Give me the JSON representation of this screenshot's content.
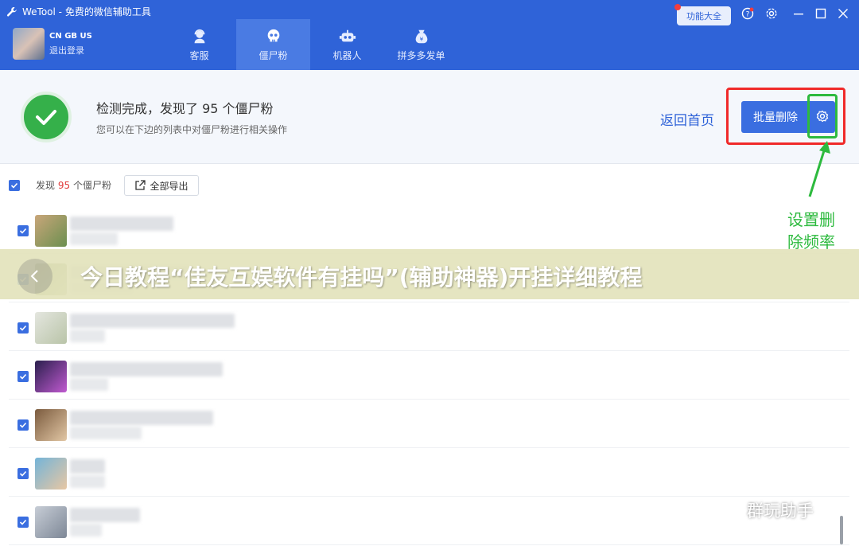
{
  "window": {
    "title": "WeTool - 免费的微信辅助工具"
  },
  "user": {
    "name": "CN GB US",
    "logout_label": "退出登录"
  },
  "tabs": [
    {
      "label": "客服",
      "icon": "support-agent-icon",
      "active": false
    },
    {
      "label": "僵尸粉",
      "icon": "skull-icon",
      "active": true
    },
    {
      "label": "机器人",
      "icon": "robot-icon",
      "active": false
    },
    {
      "label": "拼多多发单",
      "icon": "money-bag-icon",
      "active": false
    }
  ],
  "toolbar_right": {
    "feature_label": "功能大全"
  },
  "status": {
    "title": "检测完成，发现了 95 个僵尸粉",
    "subtitle": "您可以在下边的列表中对僵尸粉进行相关操作",
    "back_home_label": "返回首页",
    "batch_delete_label": "批量删除"
  },
  "annotation": {
    "line1": "设置删",
    "line2": "除频率"
  },
  "list_toolbar": {
    "found_prefix": "发现",
    "found_count": "95",
    "found_suffix": "个僵尸粉",
    "export_label": "全部导出"
  },
  "rows": [
    {
      "checked": true,
      "avatar_colors": [
        "#c9a67a",
        "#6b8f4f"
      ]
    },
    {
      "checked": true,
      "avatar_colors": [
        "#8a9a6a",
        "#c9d0b0"
      ]
    },
    {
      "checked": true,
      "avatar_colors": [
        "#e4e6df",
        "#b9c4a8"
      ]
    },
    {
      "checked": true,
      "avatar_colors": [
        "#2a1f4d",
        "#c05ad0"
      ]
    },
    {
      "checked": true,
      "avatar_colors": [
        "#7b5b3e",
        "#e2c7a5"
      ]
    },
    {
      "checked": true,
      "avatar_colors": [
        "#74b4d8",
        "#e8c7a3"
      ]
    },
    {
      "checked": true,
      "avatar_colors": [
        "#c7cdd6",
        "#7d8796"
      ]
    }
  ],
  "banner": {
    "title": "今日教程“佳友互娱软件有挂吗”(辅助神器)开挂详细教程"
  },
  "watermark": {
    "text": "群玩助手"
  },
  "colors": {
    "header": "#2f63d8",
    "accent": "#3a6ee0",
    "success": "#35b04a",
    "highlight_red": "#f02a2a",
    "highlight_green": "#2dba3e"
  }
}
